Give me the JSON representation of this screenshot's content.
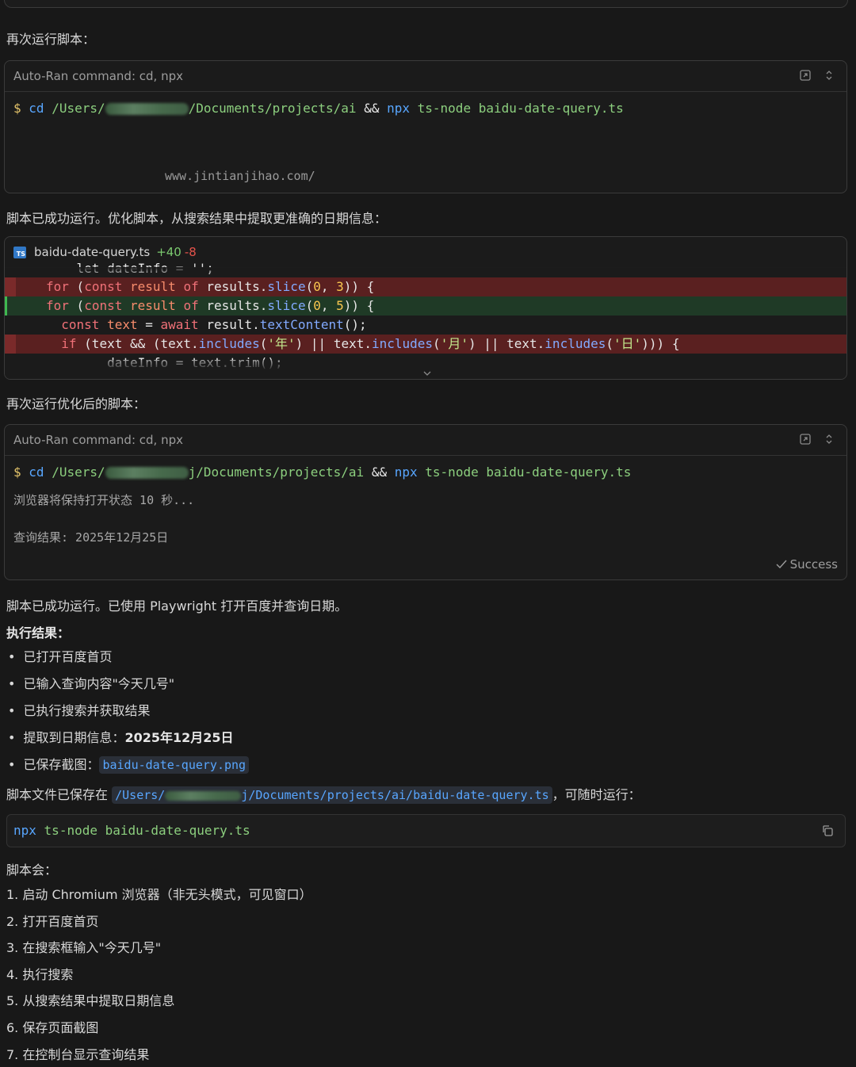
{
  "rerun_label": "再次运行脚本：",
  "cmd1": {
    "header": "Auto-Ran command: cd, npx",
    "prompt": "$",
    "cd": "cd",
    "path_start": "/Users/",
    "path_end": "/Documents/projects/ai",
    "and": "&&",
    "npx": "npx",
    "rest": "ts-node baidu-date-query.ts",
    "watermark": "www.jintianjihao.com/"
  },
  "optimize_label": "脚本已成功运行。优化脚本，从搜索结果中提取更准确的日期信息：",
  "diff": {
    "filename": "baidu-date-query.ts",
    "icon_label": "TS",
    "added": "+40",
    "removed": "-8",
    "lines": [
      {
        "type": "context",
        "text": "    let dateInfo = '';"
      },
      {
        "type": "del",
        "text": "    for (const result of results.slice(0, 3)) {"
      },
      {
        "type": "add",
        "text": "    for (const result of results.slice(0, 5)) {"
      },
      {
        "type": "context",
        "text": "      const text = await result.textContent();"
      },
      {
        "type": "del",
        "text": "      if (text && (text.includes('年') || text.includes('月') || text.includes('日'))) {"
      },
      {
        "type": "context",
        "text": "        dateInfo = text.trim();"
      }
    ]
  },
  "rerun_optimized_label": "再次运行优化后的脚本：",
  "cmd2": {
    "header": "Auto-Ran command: cd, npx",
    "prompt": "$",
    "cd": "cd",
    "path_start": "/Users/",
    "path_end": "j/Documents/projects/ai",
    "and": "&&",
    "npx": "npx",
    "rest": "ts-node baidu-date-query.ts",
    "output_1": "浏览器将保持打开状态 10 秒...",
    "output_2": "查询结果: 2025年12月25日",
    "status": "Success"
  },
  "summary_line": "脚本已成功运行。已使用 Playwright 打开百度并查询日期。",
  "results_heading": "执行结果：",
  "results": {
    "item1": "已打开百度首页",
    "item2": "已输入查询内容\"今天几号\"",
    "item3": "已执行搜索并获取结果",
    "item4_prefix": "提取到日期信息：",
    "item4_value": "2025年12月25日",
    "item5_prefix": "已保存截图：",
    "item5_file": "baidu-date-query.png"
  },
  "saved": {
    "prefix": "脚本文件已保存在",
    "path_start": "/Users/",
    "path_end": "j/Documents/projects/ai/baidu-date-query.ts",
    "suffix": "，可随时运行："
  },
  "snippet": {
    "npx": "npx",
    "rest": "ts-node baidu-date-query.ts"
  },
  "steps_heading": "脚本会：",
  "steps": [
    "1. 启动 Chromium 浏览器（非无头模式，可见窗口）",
    "2. 打开百度首页",
    "3. 在搜索框输入\"今天几号\"",
    "4. 执行搜索",
    "5. 从搜索结果中提取日期信息",
    "6. 保存页面截图",
    "7. 在控制台显示查询结果"
  ],
  "icons": {
    "open": "open-external-icon",
    "expand": "expand-collapse-icon",
    "copy": "copy-icon",
    "check": "check-icon",
    "chevron": "chevron-down-icon"
  }
}
